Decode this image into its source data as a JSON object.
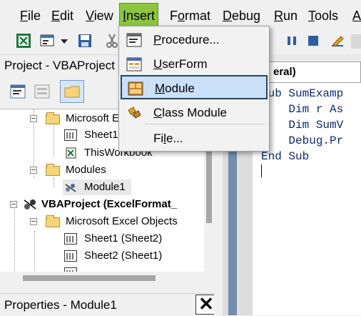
{
  "menubar": {
    "items": [
      {
        "label": "File",
        "underline": "F"
      },
      {
        "label": "Edit",
        "underline": "E"
      },
      {
        "label": "View",
        "underline": "V"
      },
      {
        "label": "Insert",
        "underline": "I"
      },
      {
        "label": "Format",
        "underline": "o"
      },
      {
        "label": "Debug",
        "underline": "D"
      },
      {
        "label": "Run",
        "underline": "R"
      },
      {
        "label": "Tools",
        "underline": "T"
      },
      {
        "label": "A",
        "underline": "A"
      }
    ],
    "active": "Insert"
  },
  "insert_menu": {
    "items": [
      {
        "label": "Procedure...",
        "underline": "P"
      },
      {
        "label": "UserForm",
        "underline": "U"
      },
      {
        "label": "Module",
        "underline": "M"
      },
      {
        "label": "Class Module",
        "underline": "C"
      },
      {
        "label": "File...",
        "underline": "l"
      }
    ],
    "selected": "Module"
  },
  "project_pane": {
    "title": "Project - VBAProject",
    "tree": [
      {
        "label": "Microsoft E",
        "bold": false,
        "icon": "folder-icon"
      },
      {
        "label": "Sheet1",
        "bold": false,
        "icon": "sheet-icon"
      },
      {
        "label": "ThisWorkbook",
        "bold": false,
        "icon": "workbook-icon"
      },
      {
        "label": "Modules",
        "bold": false,
        "icon": "folder-icon"
      },
      {
        "label": "Module1",
        "bold": false,
        "icon": "module-icon"
      },
      {
        "label": "VBAProject (ExcelFormat_",
        "bold": true,
        "icon": "vbaproject-icon"
      },
      {
        "label": "Microsoft Excel Objects",
        "bold": false,
        "icon": "folder-icon"
      },
      {
        "label": "Sheet1 (Sheet2)",
        "bold": false,
        "icon": "sheet-icon"
      },
      {
        "label": "Sheet2 (Sheet1)",
        "bold": false,
        "icon": "sheet-icon"
      }
    ]
  },
  "properties_pane": {
    "title": "Properties - Module1",
    "close_glyph": "✕"
  },
  "code_window": {
    "object_combo": "eral)",
    "lines": [
      "Sub SumExamp",
      "    Dim r As",
      "    Dim SumV",
      "    Debug.Pr",
      "End Sub"
    ]
  },
  "colors": {
    "menu_active": "#8cc63f",
    "selection": "#c9e0f7",
    "selection_border": "#26445e",
    "code_keyword": "#0b2a7a"
  }
}
